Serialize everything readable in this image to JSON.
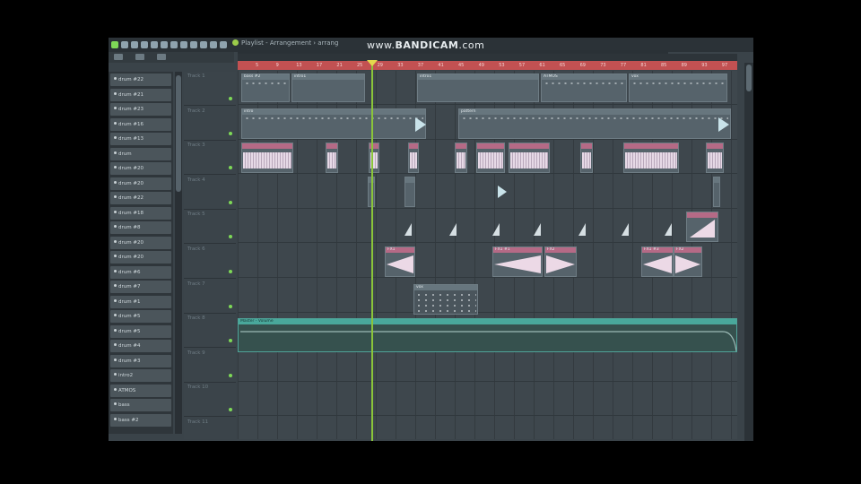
{
  "toolbar": {
    "title": "Playlist - Arrangement › arrang",
    "watermark_prefix": "www.",
    "watermark_brand": "BANDICAM",
    "watermark_suffix": ".com"
  },
  "channels": [
    "drum #22",
    "drum #21",
    "drum #23",
    "drum #16",
    "drum #13",
    "drum",
    "drum #20",
    "drum #20",
    "drum #22",
    "drum #18",
    "drum #8",
    "drum #20",
    "drum #20",
    "drum #6",
    "drum #7",
    "drum #1",
    "drum #5",
    "drum #5",
    "drum #4",
    "drum #3",
    "intro2",
    "ATMOS",
    "bass",
    "bass #2"
  ],
  "tracks": [
    "Track 1",
    "Track 2",
    "Track 3",
    "Track 4",
    "Track 5",
    "Track 6",
    "Track 7",
    "Track 8",
    "Track 9",
    "Track 10",
    "Track 11"
  ],
  "ruler": [
    "5",
    "9",
    "13",
    "17",
    "21",
    "25",
    "29",
    "33",
    "37",
    "41",
    "45",
    "49",
    "53",
    "57",
    "61",
    "65",
    "69",
    "73",
    "77",
    "81",
    "85",
    "89",
    "93",
    "97"
  ],
  "clips": {
    "t1a": "bass #2",
    "t1b": "intro1",
    "t1c": "intro1",
    "t1d": "ATMOS",
    "t1e": "vox",
    "t2a": "intro",
    "t2b": "pattern",
    "t6a": "FX1",
    "t6b": "FX1 #1",
    "t6c": "FX2",
    "t6d": "FX1 #3",
    "t6e": "FX2",
    "t7a": "vox",
    "t8a": "Master - Volume"
  },
  "colors": {
    "ruler": "#c25152",
    "playhead": "#8ac53a",
    "accent": "#49a89b"
  }
}
